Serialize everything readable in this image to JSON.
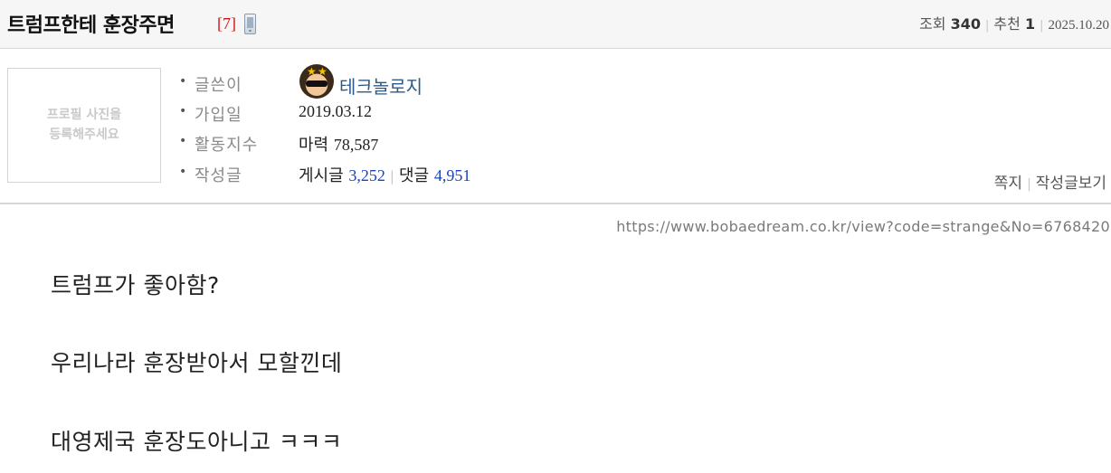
{
  "post": {
    "title": "트럼프한테 훈장주면",
    "comment_count": "[7]",
    "device_icon": "mobile-phone-icon",
    "meta": {
      "views_label": "조회",
      "views": "340",
      "recommend_label": "추천",
      "recommend": "1",
      "date": "2025.10.20"
    }
  },
  "profile": {
    "photo_placeholder_line1": "프로필 사진을",
    "photo_placeholder_line2": "등록해주세요",
    "writer_label": "글쓴이",
    "writer_name": "테크놀로지",
    "joined_label": "가입일",
    "joined_value": "2019.03.12",
    "activity_label": "활동지수",
    "activity_prefix": "마력",
    "activity_value": "78,587",
    "posts_label": "작성글",
    "posts_prefix": "게시글",
    "posts_value": "3,252",
    "comments_prefix": "댓글",
    "comments_value": "4,951",
    "message_link": "쪽지",
    "view_posts_link": "작성글보기"
  },
  "content": {
    "url": "https://www.bobaedream.co.kr/view?code=strange&No=6768420",
    "lines": [
      "트럼프가 좋아함?",
      "우리나라 훈장받아서 모할낀데",
      "대영제국 훈장도아니고 ㅋㅋㅋ"
    ]
  },
  "colors": {
    "comment_count": "#d41010",
    "count_value": "#1a44b8",
    "nickname": "#2d5a8a"
  }
}
